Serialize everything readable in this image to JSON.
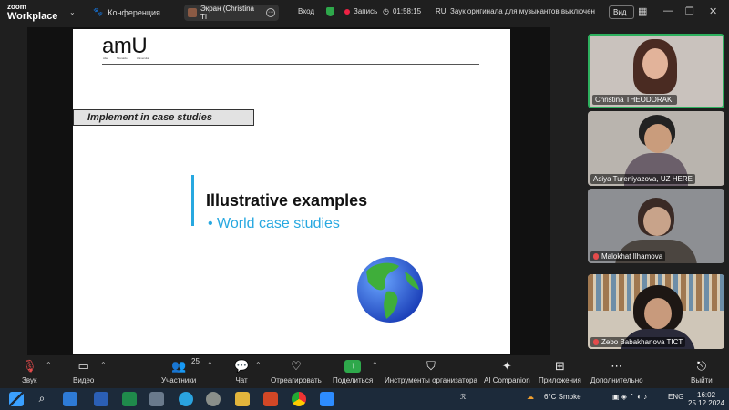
{
  "app": {
    "brand_line1": "zoom",
    "brand_line2": "Workplace"
  },
  "topbar": {
    "meeting_label": "Конференция",
    "share_label": "Экран (Christina TI",
    "login_label": "Вход",
    "record_label": "Запись",
    "timer": "01:58:15",
    "lang": "RU",
    "notice": "Заук оригинала для музыкантов выключен",
    "view_label": "Вид"
  },
  "slide": {
    "logo": "amU",
    "logo_sub": [
      "Alte",
      "Monaldo",
      "Università"
    ],
    "banner": "Implement in case studies",
    "title": "Illustrative examples",
    "bullet": "• World case studies"
  },
  "participants": [
    {
      "name": "Christina THEODORAKI",
      "muted": false,
      "active": true
    },
    {
      "name": "Asiya Tureniyazova, UZ HERE",
      "muted": false,
      "active": false
    },
    {
      "name": "Malokhat Ilhamova",
      "muted": true,
      "active": false
    },
    {
      "name": "Zebo Babakhanova TICT",
      "muted": true,
      "active": false
    }
  ],
  "toolbar": {
    "audio": "Звук",
    "video": "Видео",
    "participants": "Участники",
    "participants_count": "25",
    "chat": "Чат",
    "react": "Отреагировать",
    "share": "Поделиться",
    "host_tools": "Инструменты организатора",
    "ai": "AI Companion",
    "apps": "Приложения",
    "more": "Дополнительно",
    "leave": "Выйти"
  },
  "taskbar": {
    "weather": "6°C  Smoke",
    "lang": "ENG",
    "time": "16:02",
    "date": "25.12.2024"
  },
  "colors": {
    "accent_green": "#2ea84b",
    "slide_blue": "#27a8e0",
    "mute_red": "#e34b4b"
  }
}
